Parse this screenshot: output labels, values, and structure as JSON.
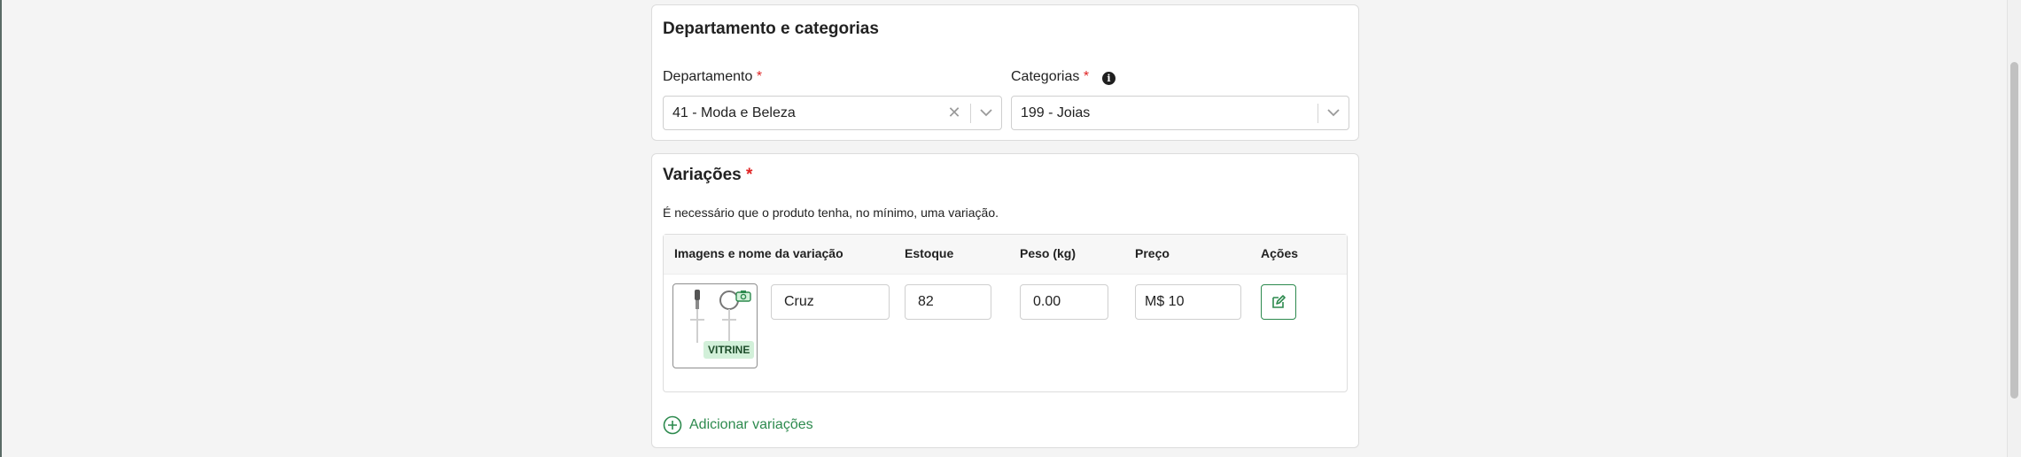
{
  "department_section": {
    "title": "Departamento e categorias",
    "department_label": "Departamento",
    "department_value": "41 - Moda e Beleza",
    "categories_label": "Categorias",
    "categories_value": "199 - Joias",
    "required_mark": "*",
    "info_glyph": "i"
  },
  "variations_section": {
    "title": "Variações",
    "required_mark": "*",
    "description": "É necessário que o produto tenha, no mínimo, uma variação.",
    "columns": [
      "Imagens e nome da variação",
      "Estoque",
      "Peso (kg)",
      "Preço",
      "Ações"
    ],
    "row": {
      "name": "Cruz",
      "stock": "82",
      "weight": "0.00",
      "price": "M$ 10",
      "badge": "VITRINE"
    },
    "add_label": "Adicionar variações"
  },
  "colors": {
    "accent_green": "#2d8a4e",
    "required_red": "#e02424"
  },
  "icons": [
    "clear-icon",
    "chevron-down-icon",
    "info-icon",
    "camera-icon",
    "edit-icon",
    "plus-circle-icon"
  ]
}
